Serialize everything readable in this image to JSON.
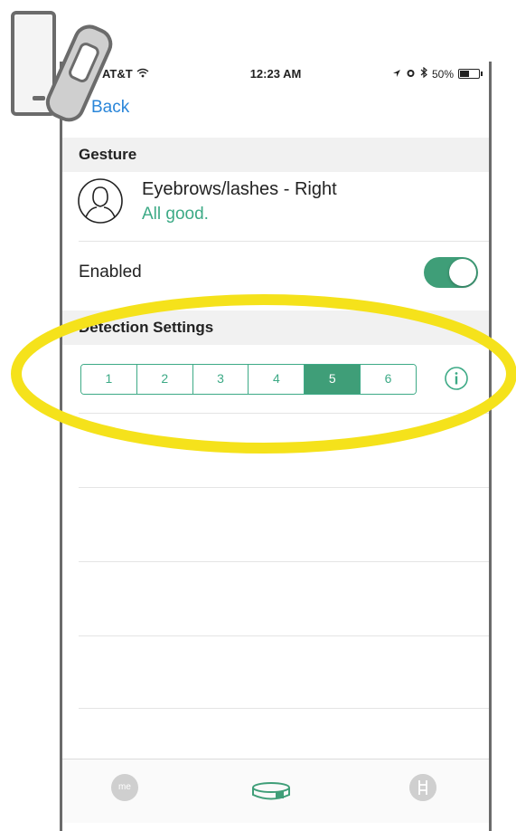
{
  "status_bar": {
    "carrier": "AT&T",
    "time": "12:23 AM",
    "battery": "50%",
    "battery_level": 0.5
  },
  "nav": {
    "back_label": "Back"
  },
  "gesture_section": {
    "header": "Gesture",
    "gesture_name": "Eyebrows/lashes - Right",
    "gesture_status": "All good."
  },
  "enabled_row": {
    "label": "Enabled",
    "value": true
  },
  "detection_section": {
    "header": "Detection Settings",
    "options": [
      "1",
      "2",
      "3",
      "4",
      "5",
      "6"
    ],
    "selected": "5"
  },
  "tab_bar": {
    "me_label": "me"
  },
  "colors": {
    "accent": "#3f9e78",
    "link": "#2a86d9",
    "highlight": "#f5e21b"
  }
}
